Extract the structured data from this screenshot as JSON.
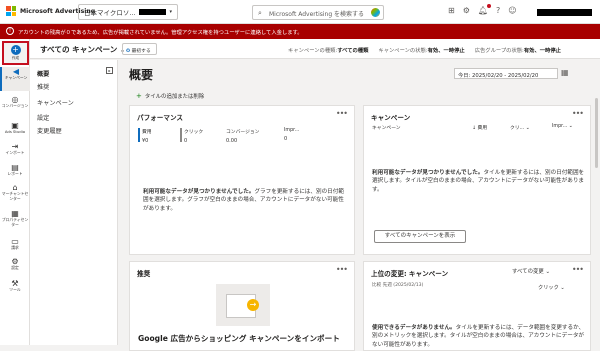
{
  "topbar": {
    "brand": "Microsoft Advertising",
    "account": "日本マイクロソ...",
    "search_placeholder": "Microsoft Advertising を検索する"
  },
  "alert": {
    "text": "アカウントの残高が０であるため、広告が掲載されていません。管理アクセス権を持つユーザーに連絡して入金します。"
  },
  "leftnav": {
    "create": "作成",
    "items": [
      {
        "icon": "campaign-icon",
        "label": "キャンペーン"
      },
      {
        "icon": "conversion-icon",
        "label": "コンバージョン"
      },
      {
        "icon": "ads-studio-icon",
        "label": "Ads Studio"
      },
      {
        "icon": "import-icon",
        "label": "インポート"
      },
      {
        "icon": "report-icon",
        "label": "レポート"
      },
      {
        "icon": "marketplace-icon",
        "label": "マーチャントセンター"
      },
      {
        "icon": "property-icon",
        "label": "プロパティセンター"
      },
      {
        "icon": "billing-icon",
        "label": "請求"
      },
      {
        "icon": "settings-icon",
        "label": "設定"
      },
      {
        "icon": "tools-icon",
        "label": "ツール"
      }
    ]
  },
  "selector": {
    "title": "すべての キャンペーン",
    "favorite": "最初する",
    "filters": [
      {
        "label": "キャンペーンの種類:",
        "value": "すべての種類"
      },
      {
        "label": "キャンペーンの状態:",
        "value": "有効、一時停止"
      },
      {
        "label": "広告グループの状態:",
        "value": "有効、一時停止"
      }
    ]
  },
  "subnav": {
    "items": [
      "概要",
      "推奨",
      "キャンペーン",
      "設定",
      "変更履歴"
    ]
  },
  "main": {
    "title": "概要",
    "date_range": "今日: 2025/02/20 - 2025/02/20",
    "add_tile": "タイルの追加または削除"
  },
  "performance": {
    "title": "パフォーマンス",
    "metrics": [
      {
        "label": "費用",
        "value": "¥0",
        "color": "#0f6cbd"
      },
      {
        "label": "クリック",
        "value": "0",
        "color": "#8a8886"
      },
      {
        "label": "コンバージョン",
        "value": "0.00",
        "color": "#ffffff"
      },
      {
        "label": "Impr...",
        "value": "0",
        "color": "#ffffff"
      }
    ],
    "empty_title": "利用可能なデータが見つかりませんでした。",
    "empty_text": "グラフを更新するには、別の日付範囲を選択します。グラフが空白のままの場合、アカウントにデータがない可能性があります。"
  },
  "campaigns": {
    "title": "キャンペーン",
    "columns": [
      "キャンペーン",
      "費用",
      "クリ...",
      "Impr..."
    ],
    "empty_title": "利用可能なデータが見つかりませんでした。",
    "empty_text": "タイルを更新するには、別の日付範囲を選択します。タイルが空白のままの場合、アカウントにデータがない可能性があります。",
    "all_button": "すべてのキャンペーンを表示"
  },
  "recommendations": {
    "title": "推奨",
    "headline": "Google 広告からショッピング キャンペーンをインポート"
  },
  "top_changes": {
    "title": "上位の変更: キャンペーン",
    "filter": "すべての変更",
    "compare": "比較 先週 (2025/02/13)",
    "metric": "クリック",
    "empty_title": "使用できるデータがありません。",
    "empty_text": "タイルを更新するには、データ範囲を変更するか、別のメトリックを選択します。タイルが空白のままの場合は、アカウントにデータがない可能性があります。"
  }
}
